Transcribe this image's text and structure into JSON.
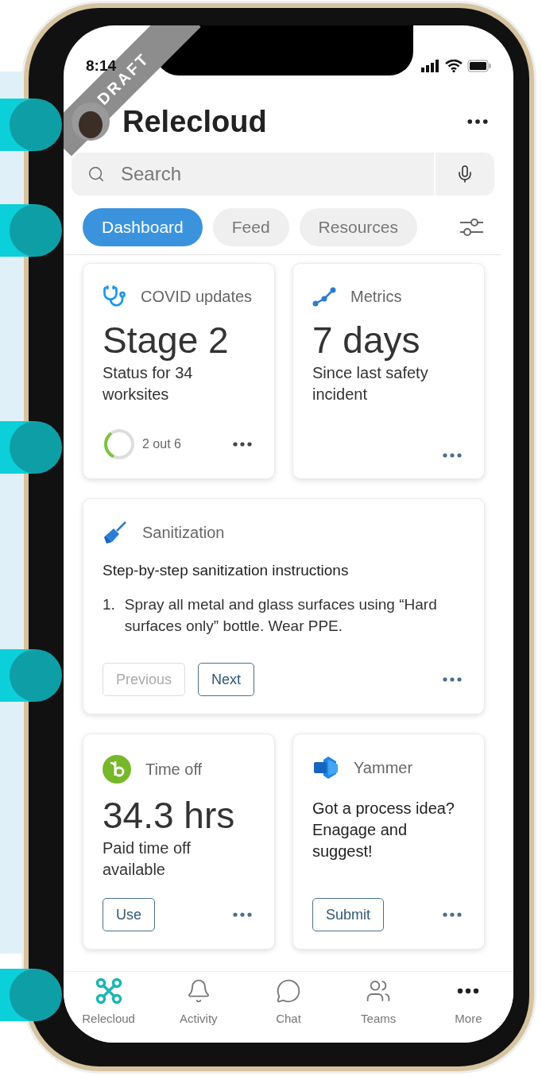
{
  "status_bar": {
    "time": "8:14"
  },
  "ribbon": {
    "label": "DRAFT"
  },
  "header": {
    "title": "Relecloud"
  },
  "search": {
    "placeholder": "Search"
  },
  "tabs": [
    {
      "label": "Dashboard",
      "selected": true
    },
    {
      "label": "Feed",
      "selected": false
    },
    {
      "label": "Resources",
      "selected": false
    }
  ],
  "cards": [
    {
      "kind": "stat",
      "title": "COVID updates",
      "value": "Stage 2",
      "caption": "Status for 34 worksites",
      "progress": {
        "level": 0.3,
        "label": "2 out 6"
      }
    },
    {
      "kind": "stat",
      "title": "Metrics",
      "value": "7 days",
      "caption": "Since last safety incident"
    },
    {
      "kind": "steps",
      "title": "Sanitization",
      "heading": "Step-by-step sanitization instructions",
      "steps": [
        {
          "number": "1.",
          "text": "Spray all metal and glass surfaces using “Hard surfaces only” bottle. Wear PPE."
        }
      ],
      "buttons": [
        {
          "label": "Previous",
          "disabled": true
        },
        {
          "label": "Next",
          "disabled": false
        }
      ]
    },
    {
      "kind": "stat",
      "title": "Time off",
      "value": "34.3 hrs",
      "caption": "Paid time off available",
      "buttons": [
        {
          "label": "Use",
          "disabled": false
        }
      ]
    },
    {
      "kind": "message",
      "title": "Yammer",
      "message": "Got a process idea? Enagage and suggest!",
      "buttons": [
        {
          "label": "Submit",
          "disabled": false
        }
      ]
    }
  ],
  "nav": [
    {
      "label": "Relecloud",
      "selected": true
    },
    {
      "label": "Activity",
      "selected": false
    },
    {
      "label": "Chat",
      "selected": false
    },
    {
      "label": "Teams",
      "selected": false
    },
    {
      "label": "More",
      "selected": false
    }
  ]
}
